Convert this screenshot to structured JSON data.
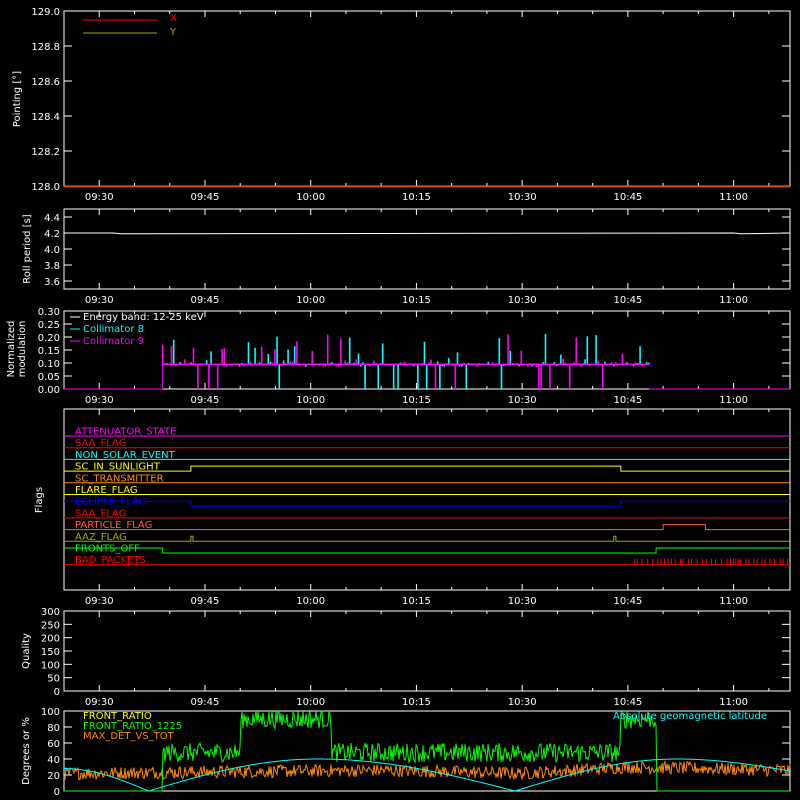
{
  "time_ticks": [
    "09:30",
    "09:45",
    "10:00",
    "10:15",
    "10:30",
    "10:45",
    "11:00"
  ],
  "colors": {
    "background": "#000000",
    "axes": "#ffffff",
    "red": "#ff0000",
    "olive": "#a8a800",
    "cyan": "#00ffff",
    "magenta": "#ff00ff",
    "green": "#00ff00",
    "orange": "#ff8c00",
    "yellow": "#ffff00",
    "blue": "#0000ff",
    "salmon": "#ff6040"
  },
  "chart_data": [
    {
      "type": "line",
      "id": "pointing",
      "title": "",
      "xlabel": "",
      "ylabel": "Pointing [°]",
      "x_range": [
        "09:25",
        "11:08"
      ],
      "ylim": [
        128.0,
        129.0
      ],
      "yticks": [
        "128.0",
        "128.2",
        "128.4",
        "128.6",
        "128.8",
        "129.0"
      ],
      "legend_placement": "top-left",
      "series": [
        {
          "name": "X",
          "color": "#ff0000",
          "values": []
        },
        {
          "name": "Y",
          "color": "#a8a800",
          "values": []
        }
      ]
    },
    {
      "type": "line",
      "id": "roll_period",
      "xlabel": "",
      "ylabel": "Roll period [s]",
      "x_range": [
        "09:25",
        "11:08"
      ],
      "ylim": [
        3.5,
        4.5
      ],
      "yticks": [
        "3.6",
        "3.8",
        "4.0",
        "4.2",
        "4.4"
      ],
      "series": [
        {
          "color": "#ffffff",
          "x": [
            "09:25",
            "09:32",
            "09:33",
            "11:00",
            "11:01",
            "11:08"
          ],
          "values": [
            4.2,
            4.2,
            4.19,
            4.2,
            4.19,
            4.2
          ]
        }
      ]
    },
    {
      "type": "bar",
      "id": "modulation",
      "ylabel": "Normalized modulation",
      "x_range": [
        "09:25",
        "11:08"
      ],
      "ylim": [
        0.0,
        0.3
      ],
      "yticks": [
        "0.00",
        "0.05",
        "0.10",
        "0.15",
        "0.20",
        "0.25",
        "0.30"
      ],
      "legend_placement": "top-left",
      "legend_title": "Energy band: 12-25 keV",
      "active_interval": [
        "09:39",
        "10:48"
      ],
      "baseline": 0.095,
      "series": [
        {
          "name": "Collimator 8",
          "color": "#00ffff"
        },
        {
          "name": "Collimator 9",
          "color": "#ff00ff"
        }
      ]
    },
    {
      "type": "line",
      "id": "flags",
      "ylabel": "Flags",
      "x_range": [
        "09:25",
        "11:08"
      ],
      "flags": [
        {
          "name": "ATTENUATOR_STATE",
          "color": "#ff00ff",
          "steps": []
        },
        {
          "name": "SAA_FLAG",
          "color": "#ff0000",
          "steps": []
        },
        {
          "name": "NON_SOLAR_EVENT",
          "color": "#00ffff",
          "steps": []
        },
        {
          "name": "SC_IN_SUNLIGHT",
          "color": "#ffff00",
          "steps": [
            [
              "09:25",
              0
            ],
            [
              "09:43",
              1
            ],
            [
              "10:44",
              0
            ]
          ]
        },
        {
          "name": "SC_TRANSMITTER",
          "color": "#ff8c00",
          "steps": []
        },
        {
          "name": "FLARE_FLAG",
          "color": "#ffff00",
          "steps": []
        },
        {
          "name": "ECLIPSE_FLAG",
          "color": "#0000ff",
          "steps": [
            [
              "09:25",
              1
            ],
            [
              "09:43",
              0
            ],
            [
              "10:44",
              1
            ]
          ]
        },
        {
          "name": "SAA_FLAG",
          "color": "#ff0000",
          "steps": []
        },
        {
          "name": "PARTICLE_FLAG",
          "color": "#ff6040",
          "steps": [
            [
              "09:25",
              0
            ],
            [
              "10:50",
              1
            ],
            [
              "10:56",
              0
            ]
          ]
        },
        {
          "name": "AAZ_FLAG",
          "color": "#a8a800",
          "steps": [
            [
              "09:25",
              0
            ],
            [
              "09:43",
              1
            ],
            [
              "09:43.3",
              0
            ],
            [
              "10:43",
              1
            ],
            [
              "10:43.3",
              0
            ]
          ]
        },
        {
          "name": "FRONTS_OFF",
          "color": "#00ff00",
          "steps": [
            [
              "09:25",
              1
            ],
            [
              "09:39",
              0
            ],
            [
              "10:49",
              1
            ]
          ]
        },
        {
          "name": "BAD_PACKETS",
          "color": "#ff0000",
          "spikes_interval": [
            "10:46",
            "11:08"
          ]
        }
      ]
    },
    {
      "type": "line",
      "id": "quality",
      "ylabel": "Quality",
      "x_range": [
        "09:25",
        "11:08"
      ],
      "ylim": [
        0,
        300
      ],
      "yticks": [
        "0",
        "50",
        "100",
        "150",
        "200",
        "250",
        "300"
      ],
      "series": []
    },
    {
      "type": "line",
      "id": "ratios",
      "ylabel": "Degrees or %",
      "x_range": [
        "09:25",
        "11:08"
      ],
      "ylim": [
        0,
        100
      ],
      "yticks": [
        "0",
        "20",
        "40",
        "60",
        "80",
        "100"
      ],
      "legend_placement": "top-left",
      "series": [
        {
          "name": "FRONT_RATIO",
          "color": "#ffff00"
        },
        {
          "name": "FRONT_RATIO_1225",
          "color": "#00ff00",
          "x": [
            "09:25",
            "09:39",
            "09:50",
            "10:03",
            "10:44",
            "10:49",
            "11:08"
          ],
          "values": [
            0,
            48,
            90,
            48,
            90,
            0,
            0
          ]
        },
        {
          "name": "MAX_DET_VS_TOT",
          "color": "#ff8c00",
          "x": [
            "09:25",
            "10:10",
            "10:30",
            "10:45",
            "11:08"
          ],
          "values": [
            22,
            26,
            22,
            30,
            26
          ]
        },
        {
          "name": "Absolute geomagnetic latitude",
          "color": "#00ffff",
          "x": [
            "09:25",
            "09:37",
            "10:01",
            "10:29",
            "10:52",
            "11:08"
          ],
          "values": [
            28,
            0,
            40,
            0,
            40,
            25
          ]
        }
      ]
    }
  ]
}
